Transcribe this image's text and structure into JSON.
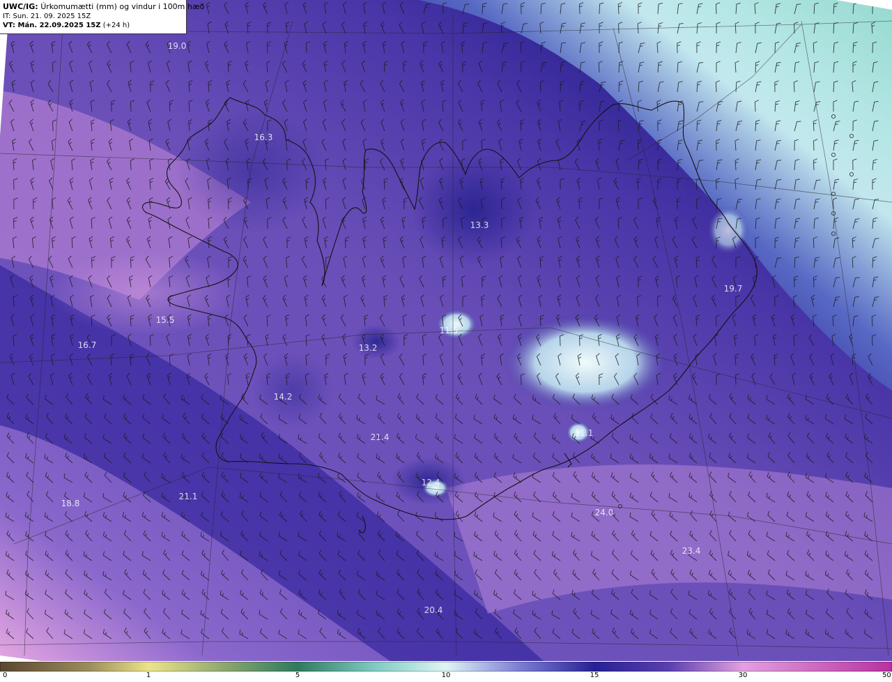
{
  "header": {
    "model": "UWC/IG:",
    "title": "Úrkomumætti (mm) og vindur i 100m hæð",
    "it_line": "IT: Sun. 21. 09. 2025 15Z",
    "vt_prefix": "VT: Mán. 22.09.2025 15Z",
    "vt_suffix": "(+24 h)"
  },
  "map_labels": [
    {
      "text": "19.0"
    },
    {
      "text": "16.3"
    },
    {
      "text": "13.3"
    },
    {
      "text": "19.7"
    },
    {
      "text": "15.5"
    },
    {
      "text": "16.7"
    },
    {
      "text": "11.5"
    },
    {
      "text": "13.2"
    },
    {
      "text": "14.2"
    },
    {
      "text": "11.1"
    },
    {
      "text": "21.4"
    },
    {
      "text": "12.4"
    },
    {
      "text": "18.8"
    },
    {
      "text": "21.1"
    },
    {
      "text": "24.0"
    },
    {
      "text": "23.4"
    },
    {
      "text": "20.4"
    }
  ],
  "colorbar": {
    "ticks": [
      "0",
      "1",
      "5",
      "10",
      "15",
      "30",
      "50"
    ],
    "colors": [
      "#5a4632",
      "#b7ad6a",
      "#ece38c",
      "#3f8a66",
      "#7fcbc2",
      "#dff5f5",
      "#7f80d6",
      "#262096",
      "#3d2aa0",
      "#8a62c8",
      "#e2a0e0",
      "#c43aa8"
    ]
  },
  "map_colors": {
    "background": "#7a5cc0",
    "band_dark": "#2a2090",
    "band_light": "#cfeff0",
    "pink": "#c68ad8",
    "cyan": "#9fe0d8",
    "coastline": "#1a1a1a",
    "barb": "#1a1a1a"
  }
}
